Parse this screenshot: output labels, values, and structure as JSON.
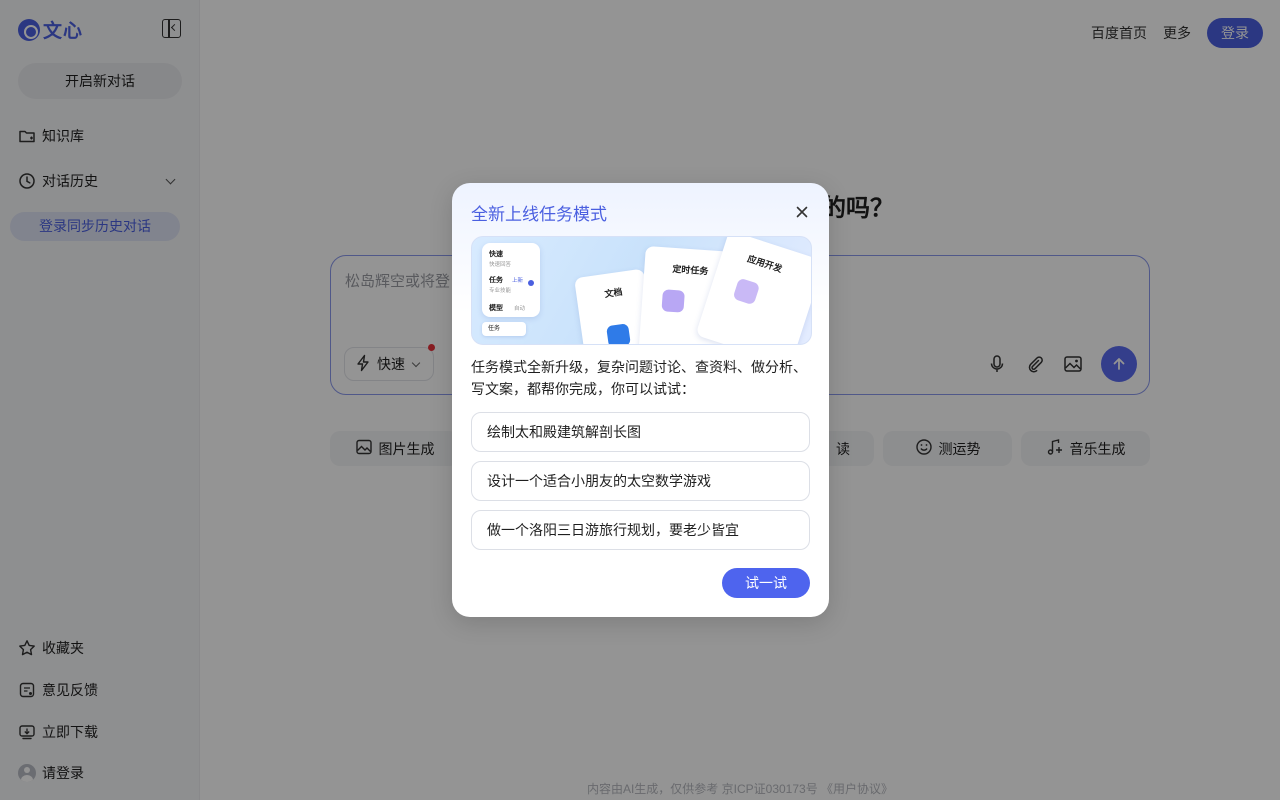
{
  "sidebar": {
    "logo_text": "文心",
    "new_chat_label": "开启新对话",
    "knowledge_base_label": "知识库",
    "history_label": "对话历史",
    "sync_history_label": "登录同步历史对话",
    "favorites_label": "收藏夹",
    "feedback_label": "意见反馈",
    "download_label": "立即下载",
    "login_label": "请登录"
  },
  "header": {
    "baidu_home_label": "百度首页",
    "more_label": "更多",
    "login_button_label": "登录"
  },
  "main": {
    "greeting_visible": "的吗？",
    "input_placeholder_visible": "松岛辉空或将登",
    "mode_label": "快速",
    "quick_actions": [
      {
        "label": "图片生成",
        "icon": "image-gen-icon"
      },
      {
        "label": "读",
        "icon": "read-icon"
      },
      {
        "label": "测运势",
        "icon": "fortune-icon"
      },
      {
        "label": "音乐生成",
        "icon": "music-icon"
      }
    ],
    "footer_text": "内容由AI生成，仅供参考  京ICP证030173号  《用户协议》"
  },
  "modal": {
    "title": "全新上线任务模式",
    "description": "任务模式全新升级，复杂问题讨论、查资料、做分析、写文案，都帮你完成，你可以试试：",
    "suggestions": [
      "绘制太和殿建筑解剖长图",
      "设计一个适合小朋友的太空数学游戏",
      "做一个洛阳三日游旅行规划，要老少皆宜"
    ],
    "try_button_label": "试一试",
    "banner": {
      "card_quick_title": "快速",
      "card_quick_sub": "快速回答",
      "card_task_title": "任务",
      "card_task_badge": "上新",
      "card_task_sub": "专业技能",
      "card_model_title": "模型",
      "card_model_value": "自动",
      "task_tag": "任务",
      "doc_label": "文档",
      "scheduled_label": "定时任务",
      "app_dev_label": "应用开发"
    }
  },
  "colors": {
    "accent": "#4a5fe0",
    "overlay": "rgba(0,0,0,0.42)"
  }
}
